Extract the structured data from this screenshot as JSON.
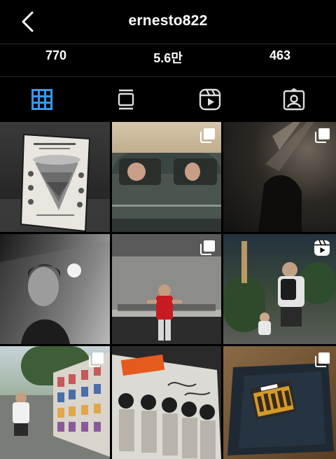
{
  "header": {
    "username": "ernesto822"
  },
  "stats": {
    "posts": "770",
    "followers": "5.6만",
    "following": "463"
  },
  "tabs": [
    {
      "icon": "grid-icon",
      "active": true
    },
    {
      "icon": "feed-icon",
      "active": false
    },
    {
      "icon": "reels-icon",
      "active": false
    },
    {
      "icon": "tagged-icon",
      "active": false
    }
  ],
  "colors": {
    "background": "#000000",
    "active_tab": "#3897f0",
    "separator": "#262626"
  },
  "grid": {
    "posts": [
      {
        "name": "poster-post",
        "badge": "none"
      },
      {
        "name": "car-post",
        "badge": "multi-photo-icon"
      },
      {
        "name": "dark-curtain-post",
        "badge": "multi-photo-icon"
      },
      {
        "name": "portrait-post",
        "badge": "none"
      },
      {
        "name": "kitchen-post",
        "badge": "multi-photo-icon"
      },
      {
        "name": "street-walk-post",
        "badge": "reel-icon"
      },
      {
        "name": "poster-wall-post",
        "badge": "multi-photo-icon"
      },
      {
        "name": "album-post",
        "badge": "none"
      },
      {
        "name": "package-post",
        "badge": "multi-photo-icon"
      }
    ]
  }
}
